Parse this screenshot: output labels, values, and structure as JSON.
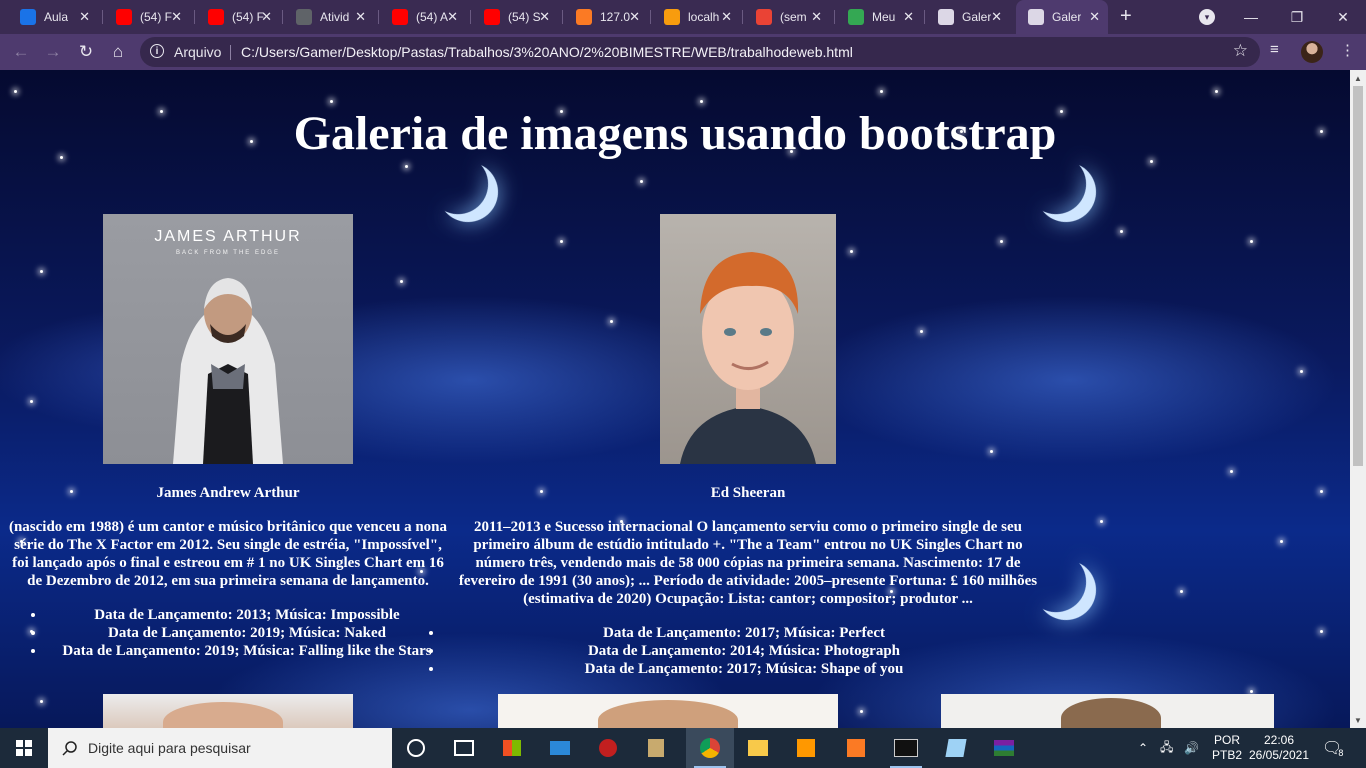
{
  "browser": {
    "tabs": [
      {
        "title": "Aula",
        "favicon": "classroom-icon",
        "color": "#1a73e8"
      },
      {
        "title": "(54) F",
        "favicon": "youtube-icon",
        "color": "#ff0000"
      },
      {
        "title": "(54) F",
        "favicon": "youtube-icon",
        "color": "#ff0000"
      },
      {
        "title": "Ativid",
        "favicon": "classroom-assignment-icon",
        "color": "#5f6368"
      },
      {
        "title": "(54) A",
        "favicon": "youtube-icon",
        "color": "#ff0000"
      },
      {
        "title": "(54) S",
        "favicon": "youtube-icon",
        "color": "#ff0000"
      },
      {
        "title": "127.0",
        "favicon": "xampp-icon",
        "color": "#fb7a24"
      },
      {
        "title": "localh",
        "favicon": "phpmyadmin-icon",
        "color": "#f89c0e"
      },
      {
        "title": "(sem",
        "favicon": "gmail-icon",
        "color": "#ea4335"
      },
      {
        "title": "Meu",
        "favicon": "drive-icon",
        "color": "#34a853"
      },
      {
        "title": "Galer",
        "favicon": "globe-icon",
        "color": "#dcd7e6"
      },
      {
        "title": "Galer",
        "favicon": "globe-icon",
        "color": "#dcd7e6"
      }
    ],
    "active_tab_index": 11,
    "address": {
      "scheme_label": "Arquivo",
      "url": "C:/Users/Gamer/Desktop/Pastas/Trabalhos/3%20ANO/2%20BIMESTRE/WEB/trabalhodeweb.html"
    },
    "accent": "#4e3a6e"
  },
  "page": {
    "title": "Galeria de imagens usando bootstrap",
    "cards": [
      {
        "name": "James Andrew Arthur",
        "album_text": "JAMES ARTHUR",
        "album_subtext": "BACK FROM THE EDGE",
        "description": "(nascido em 1988) é um cantor e músico britânico que venceu a nona série do The X Factor em 2012. Seu single de estréia, \"Impossível\", foi lançado após o final e estreou em # 1 no UK Singles Chart em 16 de Dezembro de 2012, em sua primeira semana de lançamento.",
        "songs": [
          "Data de Lançamento: 2013; Música: Impossible",
          "Data de Lançamento: 2019; Música: Naked",
          "Data de Lançamento: 2019; Música: Falling like the Stars"
        ]
      },
      {
        "name": "Ed Sheeran",
        "description": "2011–2013 e Sucesso internacional O lançamento serviu como o primeiro single de seu primeiro álbum de estúdio intitulado +. \"The a Team\" entrou no UK Singles Chart no número três, vendendo mais de 58 000 cópias na primeira semana. Nascimento: 17 de fevereiro de 1991 (30 anos); ... Período de atividade: 2005–presente Fortuna: £ 160 milhões (estimativa de 2020) Ocupação: Lista: cantor; compositor; produtor ...",
        "songs": [
          "Data de Lançamento: 2017; Música: Perfect",
          "Data de Lançamento: 2014; Música: Photograph",
          "Data de Lançamento: 2017; Música: Shape of you"
        ]
      }
    ]
  },
  "taskbar": {
    "search_placeholder": "Digite aqui para pesquisar",
    "language": "POR",
    "layout": "PTB2",
    "time": "22:06",
    "date": "26/05/2021",
    "notification_count": "8"
  }
}
